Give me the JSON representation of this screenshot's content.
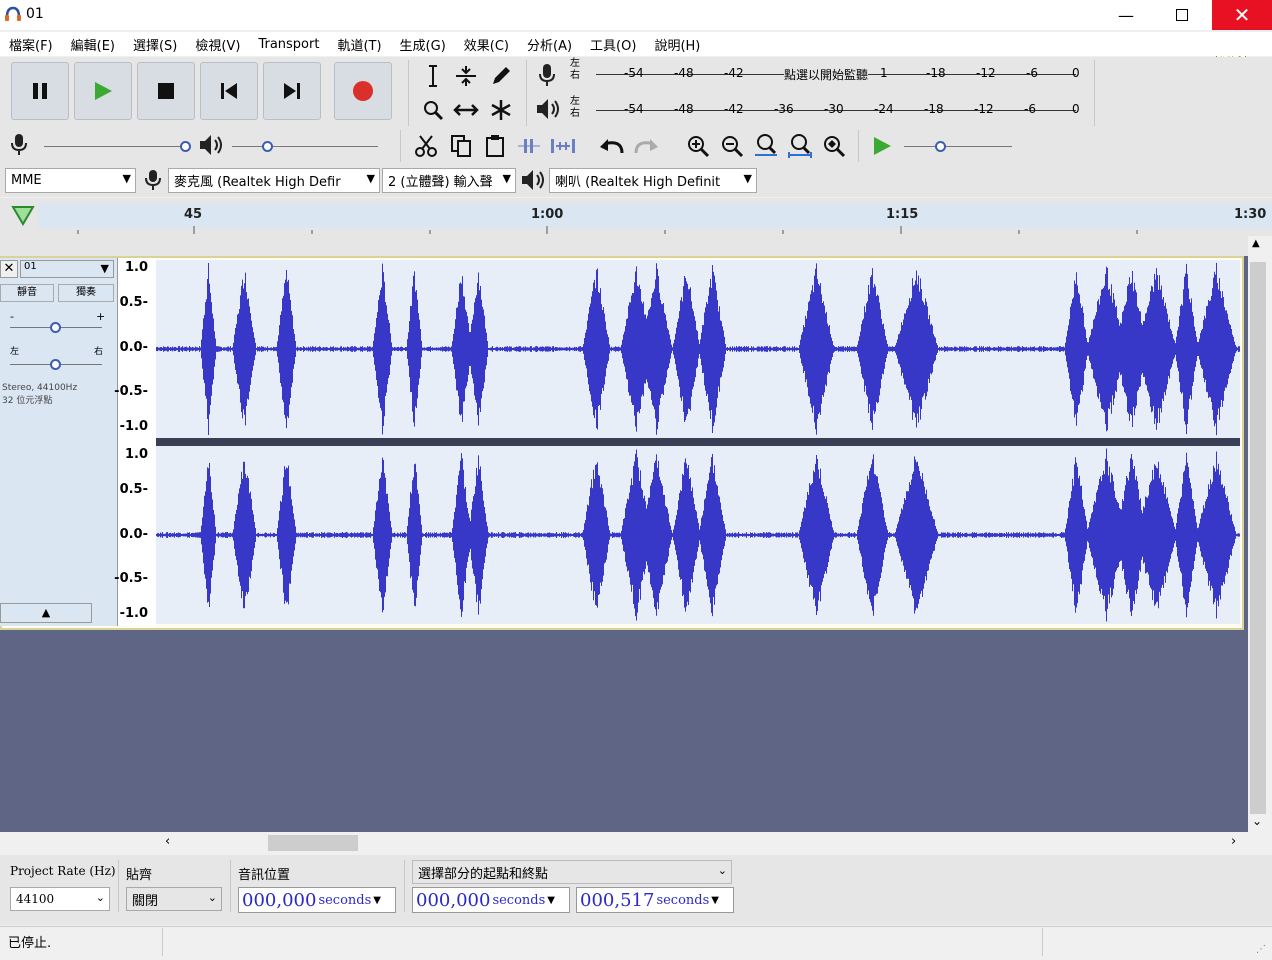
{
  "window": {
    "title": "01",
    "close_tooltip": "關閉"
  },
  "menu": [
    "檔案(F)",
    "編輯(E)",
    "選擇(S)",
    "檢視(V)",
    "Transport",
    "軌道(T)",
    "生成(G)",
    "效果(C)",
    "分析(A)",
    "工具(O)",
    "說明(H)"
  ],
  "meters": {
    "record": {
      "lr_top": "左",
      "lr_bottom": "右",
      "ticks_left": [
        "-54",
        "-48",
        "-42"
      ],
      "center_label": "點選以開始監聽",
      "ticks_right": [
        "-18",
        "-12",
        "-6",
        "0"
      ],
      "extra_tick": "1"
    },
    "playback": {
      "lr_top": "左",
      "lr_bottom": "右",
      "ticks": [
        "-54",
        "-48",
        "-42",
        "-36",
        "-30",
        "-24",
        "-18",
        "-12",
        "-6",
        "0"
      ]
    }
  },
  "devices": {
    "host": "MME",
    "recording_device": "麥克風 (Realtek High Defir",
    "channels": "2 (立體聲) 輸入聲",
    "playback_device": "喇叭 (Realtek High Definit"
  },
  "timeline": {
    "labels": [
      "45",
      "1:00",
      "1:15",
      "1:30"
    ]
  },
  "track": {
    "name": "01",
    "mute": "靜音",
    "solo": "獨奏",
    "gain_minus": "-",
    "gain_plus": "+",
    "pan_left": "左",
    "pan_right": "右",
    "info_line1": "Stereo, 44100Hz",
    "info_line2": "32 位元浮點",
    "scale": [
      "1.0",
      "0.5-",
      "0.0-",
      "-0.5-",
      "-1.0"
    ]
  },
  "selection_toolbar": {
    "project_rate_label": "Project Rate (Hz)",
    "project_rate_value": "44100",
    "snap_label": "貼齊",
    "snap_value": "關閉",
    "audio_position_label": "音訊位置",
    "audio_position": {
      "value": "000,000",
      "unit": "seconds"
    },
    "selection_mode": "選擇部分的起點和終點",
    "selection_start": {
      "value": "000,000",
      "unit": "seconds"
    },
    "selection_end": {
      "value": "000,517",
      "unit": "seconds"
    }
  },
  "status": {
    "text": "已停止."
  },
  "colors": {
    "waveform": "#3838c8",
    "waveform_bg": "#e8eef8",
    "track_area": "#5f6584",
    "record": "#d9302a",
    "play": "#3aaa35",
    "close": "#e81123"
  }
}
